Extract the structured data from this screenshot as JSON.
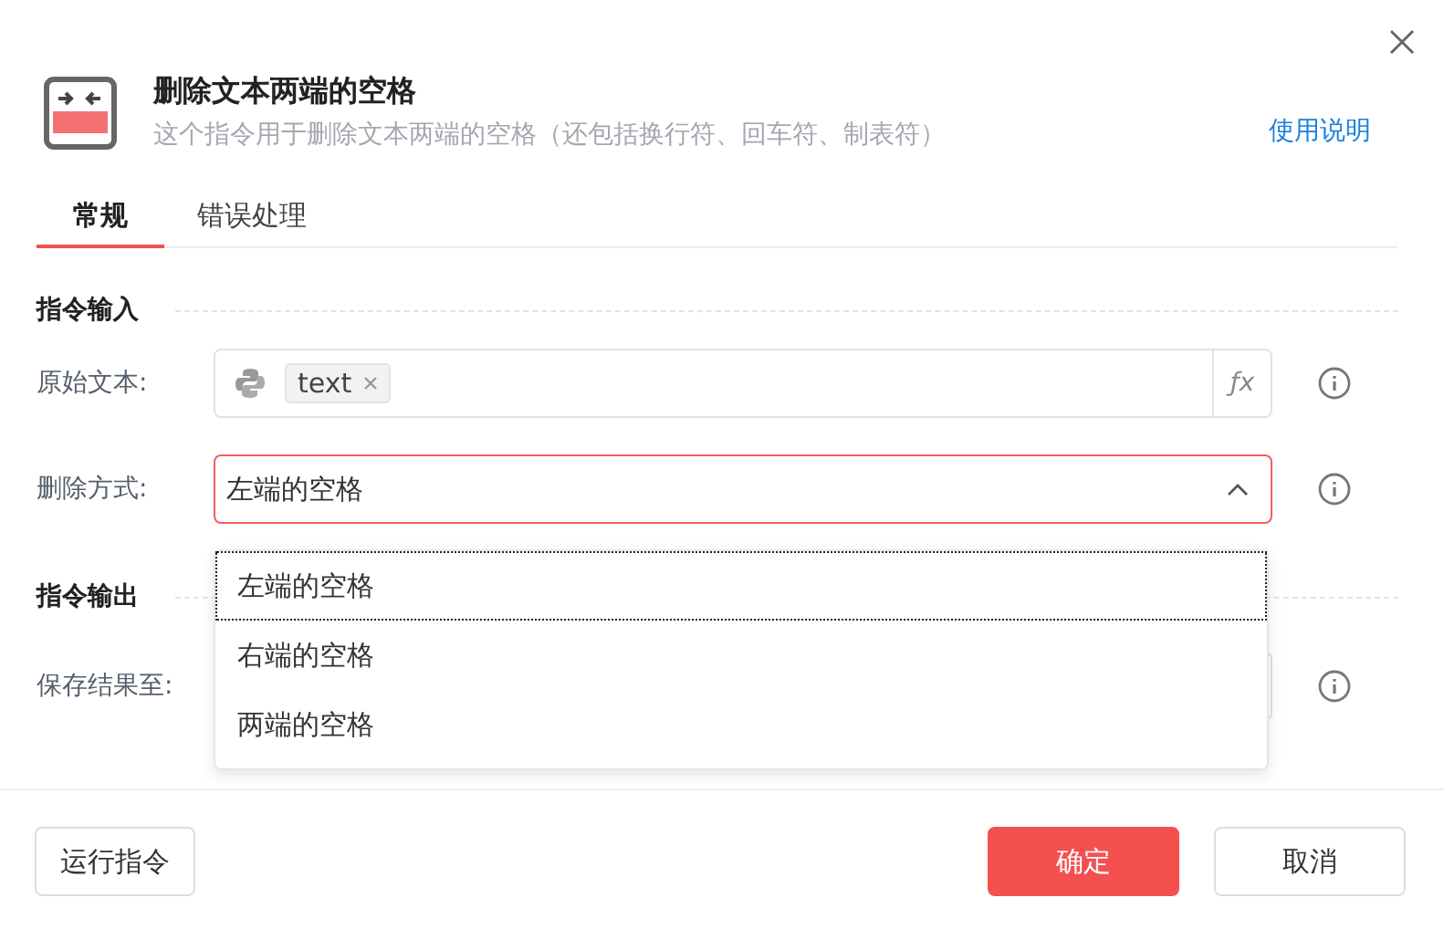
{
  "header": {
    "title": "删除文本两端的空格",
    "description": "这个指令用于删除文本两端的空格（还包括换行符、回车符、制表符）",
    "help_link": "使用说明"
  },
  "tabs": [
    {
      "label": "常规",
      "selected": true
    },
    {
      "label": "错误处理",
      "selected": false
    }
  ],
  "input_section": {
    "title": "指令输入",
    "text_field": {
      "label": "原始文本:",
      "token": "text",
      "fx": "ƒx"
    },
    "mode_field": {
      "label": "删除方式:",
      "value": "左端的空格",
      "expanded": true
    }
  },
  "output_section": {
    "title": "指令输出",
    "save_label": "保存结果至:"
  },
  "dropdown": [
    {
      "label": "左端的空格",
      "selected": true
    },
    {
      "label": "右端的空格",
      "selected": false
    },
    {
      "label": "两端的空格",
      "selected": false
    }
  ],
  "footer": {
    "run_button": "运行指令",
    "ok_button": "确定",
    "cancel_button": "取消"
  }
}
